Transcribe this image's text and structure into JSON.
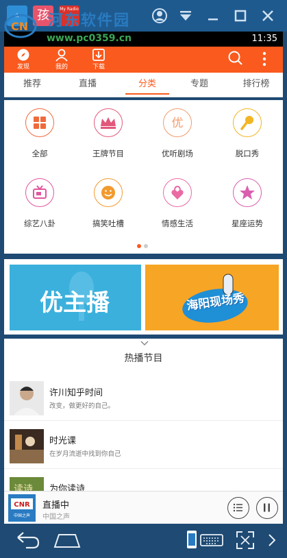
{
  "emulator": {
    "tabs": [
      {
        "glyph": "⋆",
        "color": "#2f8fd6"
      },
      {
        "glyph": "孩",
        "color": "#e8546b"
      },
      {
        "glyph": "My Radio",
        "color": "#d9312b"
      }
    ],
    "watermark_text": "河东软件园",
    "watermark_url": "www.pc0359.cn",
    "watermark_logo": "CN"
  },
  "status_bar": {
    "time": "11:35"
  },
  "header": {
    "discover_label": "发现",
    "mine_label": "我的",
    "download_label": "下载",
    "accent_color": "#fa5a1e"
  },
  "tabs": [
    {
      "label": "推荐",
      "active": false
    },
    {
      "label": "直播",
      "active": false
    },
    {
      "label": "分类",
      "active": true
    },
    {
      "label": "专题",
      "active": false
    },
    {
      "label": "排行榜",
      "active": false
    }
  ],
  "categories": [
    {
      "label": "全部",
      "icon": "grid-icon",
      "color": "#f06a3c"
    },
    {
      "label": "王牌节目",
      "icon": "crown-icon",
      "color": "#e2587a"
    },
    {
      "label": "优听剧场",
      "icon": "you-character-icon",
      "color": "#f39a6a"
    },
    {
      "label": "脱口秀",
      "icon": "microphone-icon",
      "color": "#f2b523"
    },
    {
      "label": "综艺八卦",
      "icon": "tv-icon",
      "color": "#e0569c"
    },
    {
      "label": "搞笑吐槽",
      "icon": "smiley-icon",
      "color": "#f29a2e"
    },
    {
      "label": "情感生活",
      "icon": "heart-lock-icon",
      "color": "#ea6aa3"
    },
    {
      "label": "星座运势",
      "icon": "star-icon",
      "color": "#d95fae"
    }
  ],
  "pager": {
    "active": 0,
    "count": 2
  },
  "banners": [
    {
      "text": "优主播",
      "color": "#3bb0dc"
    },
    {
      "text": "海阳现场秀",
      "color": "#f7a524"
    }
  ],
  "hot": {
    "title": "热播节目",
    "items": [
      {
        "title": "许川知乎时间",
        "subtitle": "改变，做更好的自己。"
      },
      {
        "title": "时光课",
        "subtitle": "在岁月流逝中找到你自己"
      },
      {
        "title": "为你读诗",
        "subtitle": ""
      }
    ]
  },
  "player": {
    "title": "直播中",
    "subtitle": "中国之声",
    "thumb_label": "CNR",
    "thumb_sub": "中国之声"
  }
}
